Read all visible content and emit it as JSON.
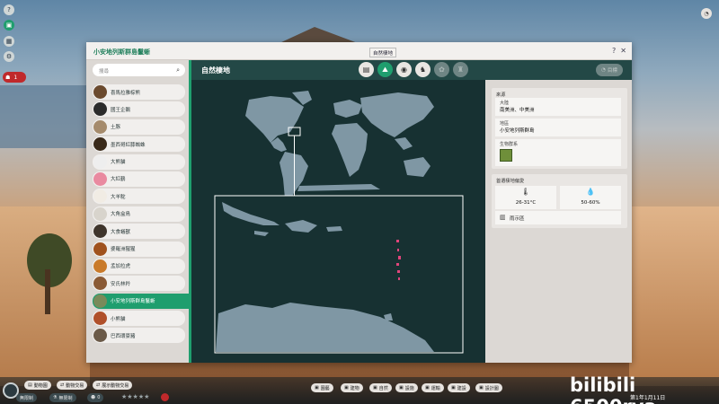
{
  "window": {
    "title": "小安地列斯群島鬣蜥",
    "help": "?",
    "close": "✕"
  },
  "tooltip": "自然棲地",
  "search": {
    "placeholder": "搜尋"
  },
  "animals": [
    {
      "name": "喜馬拉雅棕熊",
      "color": "#6b4a2e"
    },
    {
      "name": "國王企鵝",
      "color": "#2b2b2b"
    },
    {
      "name": "土豚",
      "color": "#a58b6c"
    },
    {
      "name": "墨西哥紅膝蜘蛛",
      "color": "#3a2a1a"
    },
    {
      "name": "大熊貓",
      "color": "#eeeeee"
    },
    {
      "name": "大紅鶴",
      "color": "#e98aa0"
    },
    {
      "name": "大羊駝",
      "color": "#f1ece4"
    },
    {
      "name": "大角盒鳥",
      "color": "#d8d4cc"
    },
    {
      "name": "大食蟻獸",
      "color": "#3f352c"
    },
    {
      "name": "婆羅洲猩猩",
      "color": "#a0521e"
    },
    {
      "name": "孟加拉虎",
      "color": "#c97a2a"
    },
    {
      "name": "安氏林羚",
      "color": "#8a5a35"
    },
    {
      "name": "小安地列斯群島鬣蜥",
      "color": "#7a8a5a"
    },
    {
      "name": "小熊貓",
      "color": "#b0502a"
    },
    {
      "name": "巴西環豪豬",
      "color": "#6b5a48"
    }
  ],
  "selected_index": 12,
  "content": {
    "title": "自然棲地",
    "tabs": [
      {
        "name": "info",
        "glyph": "▤"
      },
      {
        "name": "habitat",
        "glyph": "⛰"
      },
      {
        "name": "diet",
        "glyph": "◉"
      },
      {
        "name": "enrichment",
        "glyph": "♞"
      },
      {
        "name": "social",
        "glyph": "✿"
      },
      {
        "name": "breeding",
        "glyph": "♜"
      }
    ],
    "right_button": "目標"
  },
  "info": {
    "origin_title": "來源",
    "continent_label": "大陸",
    "continent_value": "南美洲、中美洲",
    "region_label": "地區",
    "region_value": "小安地列斯群島",
    "biome_label": "生物群系",
    "habitat_title": "首選棲地偏愛",
    "temperature": "26-31°C",
    "humidity": "50-60%",
    "terrain": "雨示區"
  },
  "bottom": {
    "left_pills": [
      "動物園",
      "動物交易",
      "展示動物交易"
    ],
    "money": "無限制",
    "money2": "無限制",
    "guests": "0",
    "center_pills": [
      "園藝",
      "建物",
      "自然",
      "設施",
      "運輸",
      "建設",
      "設計圖"
    ],
    "date": "第1年1月11日"
  },
  "watermark": "bilibili 6500rya",
  "colors": {
    "accent": "#1f9e6e",
    "header": "#234846",
    "map_bg": "#173132",
    "land": "#7f97a4",
    "island": "#e0457b"
  }
}
